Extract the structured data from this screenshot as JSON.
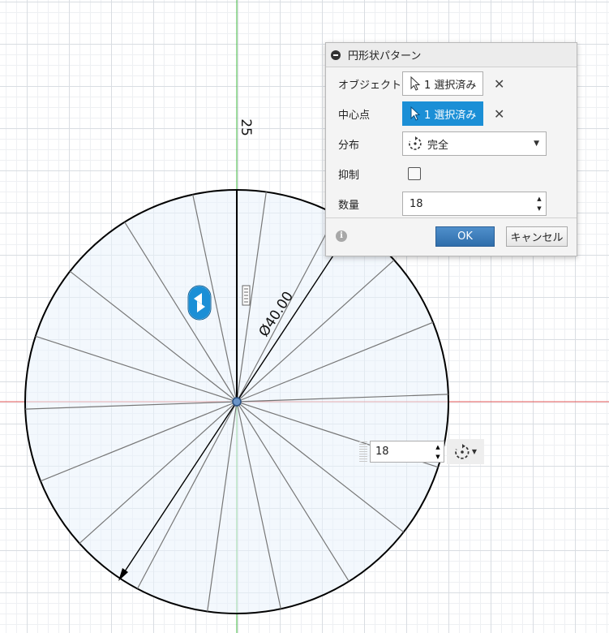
{
  "dialog": {
    "title": "円形状パターン",
    "rows": {
      "object": {
        "label": "オブジェクト",
        "value": "1 選択済み"
      },
      "center": {
        "label": "中心点",
        "value": "1 選択済み"
      },
      "distribution": {
        "label": "分布",
        "value": "完全"
      },
      "suppress": {
        "label": "抑制",
        "checked": false
      },
      "quantity": {
        "label": "数量",
        "value": "18"
      }
    },
    "ok_label": "OK",
    "cancel_label": "キャンセル"
  },
  "canvas": {
    "diameter_label": "Ø40.00",
    "top_dimension_label": "25",
    "pattern_count": 18,
    "colors": {
      "accent": "#1b8fd6",
      "x_axis": "#e05555",
      "y_axis": "#3fb83f",
      "fill": "#e9f3fb"
    }
  },
  "quantity_widget": {
    "value": "18"
  }
}
